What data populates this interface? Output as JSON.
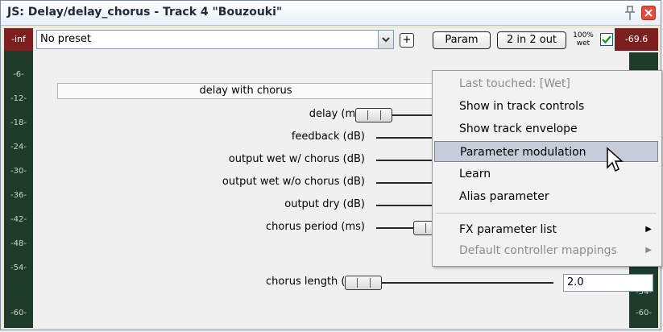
{
  "window": {
    "title": "JS: Delay/delay_chorus - Track 4 \"Bouzouki\""
  },
  "toolbar": {
    "in_level": "-inf",
    "preset": "No preset",
    "plus_label": "+",
    "param_label": "Param",
    "io_label": "2 in 2 out",
    "wet_pct": "100%",
    "wet_label": "wet",
    "wet_checked": true,
    "out_level": "-69.6"
  },
  "vu_ticks": [
    "-6-",
    "-12-",
    "-18-",
    "-24-",
    "-30-",
    "-36-",
    "-42-",
    "-48-",
    "-54-",
    "-60-"
  ],
  "effect_name": "delay with chorus",
  "params": [
    {
      "label": "delay (ms)",
      "value": ""
    },
    {
      "label": "feedback (dB)",
      "value": ""
    },
    {
      "label": "output wet w/ chorus (dB)",
      "value": ""
    },
    {
      "label": "output wet w/o chorus (dB)",
      "value": ""
    },
    {
      "label": "output dry (dB)",
      "value": ""
    },
    {
      "label": "chorus period (ms)",
      "value": ""
    },
    {
      "label": "chorus length (ms)",
      "value": "2.0"
    }
  ],
  "context_menu": {
    "items": [
      {
        "label": "Last touched: [Wet]",
        "disabled": true
      },
      {
        "label": "Show in track controls"
      },
      {
        "label": "Show track envelope"
      },
      {
        "label": "Parameter modulation",
        "highlighted": true
      },
      {
        "label": "Learn"
      },
      {
        "label": "Alias parameter"
      },
      {
        "label": "FX parameter list",
        "submenu": true
      },
      {
        "label": "Default controller mappings",
        "disabled": true,
        "submenu": true
      }
    ]
  }
}
